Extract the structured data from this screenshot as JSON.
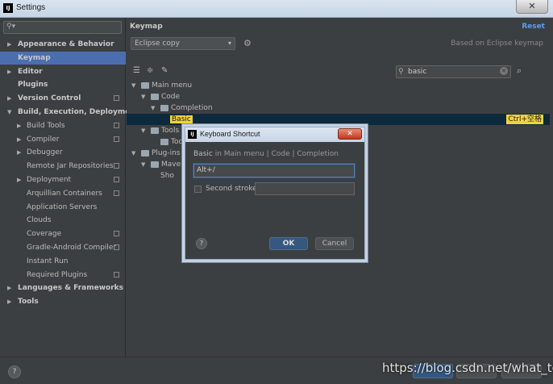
{
  "window": {
    "title": "Settings",
    "app_icon": "IJ",
    "close_glyph": "✕"
  },
  "left": {
    "search_placeholder": "",
    "items": [
      {
        "label": "Appearance & Behavior",
        "bold": true,
        "level": 0,
        "arrow": "▶",
        "proj": false
      },
      {
        "label": "Keymap",
        "bold": true,
        "level": 0,
        "arrow": "",
        "proj": false,
        "selected": true
      },
      {
        "label": "Editor",
        "bold": true,
        "level": 0,
        "arrow": "▶",
        "proj": false
      },
      {
        "label": "Plugins",
        "bold": true,
        "level": 0,
        "arrow": "",
        "proj": false
      },
      {
        "label": "Version Control",
        "bold": true,
        "level": 0,
        "arrow": "▶",
        "proj": true
      },
      {
        "label": "Build, Execution, Deployment",
        "bold": true,
        "level": 0,
        "arrow": "▼",
        "proj": false
      },
      {
        "label": "Build Tools",
        "bold": false,
        "level": 1,
        "arrow": "▶",
        "proj": true
      },
      {
        "label": "Compiler",
        "bold": false,
        "level": 1,
        "arrow": "▶",
        "proj": true
      },
      {
        "label": "Debugger",
        "bold": false,
        "level": 1,
        "arrow": "▶",
        "proj": false
      },
      {
        "label": "Remote Jar Repositories",
        "bold": false,
        "level": 1,
        "arrow": "",
        "proj": true
      },
      {
        "label": "Deployment",
        "bold": false,
        "level": 1,
        "arrow": "▶",
        "proj": true
      },
      {
        "label": "Arquillian Containers",
        "bold": false,
        "level": 1,
        "arrow": "",
        "proj": true
      },
      {
        "label": "Application Servers",
        "bold": false,
        "level": 1,
        "arrow": "",
        "proj": false
      },
      {
        "label": "Clouds",
        "bold": false,
        "level": 1,
        "arrow": "",
        "proj": false
      },
      {
        "label": "Coverage",
        "bold": false,
        "level": 1,
        "arrow": "",
        "proj": true
      },
      {
        "label": "Gradle-Android Compiler",
        "bold": false,
        "level": 1,
        "arrow": "",
        "proj": true
      },
      {
        "label": "Instant Run",
        "bold": false,
        "level": 1,
        "arrow": "",
        "proj": false
      },
      {
        "label": "Required Plugins",
        "bold": false,
        "level": 1,
        "arrow": "",
        "proj": true
      },
      {
        "label": "Languages & Frameworks",
        "bold": true,
        "level": 0,
        "arrow": "▶",
        "proj": false
      },
      {
        "label": "Tools",
        "bold": true,
        "level": 0,
        "arrow": "▶",
        "proj": false
      }
    ]
  },
  "right": {
    "title": "Keymap",
    "reset_label": "Reset",
    "keymap_selected": "Eclipse copy",
    "based_on": "Based on Eclipse keymap",
    "search_value": "basic",
    "tree": [
      {
        "label": "Main menu",
        "arrow": "▼",
        "folder": true,
        "indent": 0
      },
      {
        "label": "Code",
        "arrow": "▼",
        "folder": true,
        "indent": 1
      },
      {
        "label": "Completion",
        "arrow": "▼",
        "folder": true,
        "indent": 2
      },
      {
        "label": "Basic",
        "arrow": "",
        "folder": false,
        "indent": 3,
        "selected": true,
        "shortcut": "Ctrl+空格"
      },
      {
        "label": "Tools",
        "arrow": "▼",
        "folder": true,
        "indent": 1
      },
      {
        "label": "Too",
        "arrow": "",
        "folder": true,
        "indent": 2
      },
      {
        "label": "Plug-ins",
        "arrow": "▼",
        "folder": true,
        "indent": 0
      },
      {
        "label": "Maven",
        "arrow": "▼",
        "folder": true,
        "indent": 1
      },
      {
        "label": "Sho",
        "arrow": "",
        "folder": false,
        "indent": 2
      }
    ]
  },
  "dialog": {
    "title": "Keyboard Shortcut",
    "path_action": "Basic",
    "path_rest": " in Main menu | Code | Completion",
    "first_stroke": "Alt+/",
    "second_stroke_label": "Second stroke:",
    "ok_label": "OK",
    "cancel_label": "Cancel",
    "help_glyph": "?"
  },
  "bottom": {
    "help_glyph": "?",
    "watermark": "https://blog.csdn.net/what_to"
  }
}
